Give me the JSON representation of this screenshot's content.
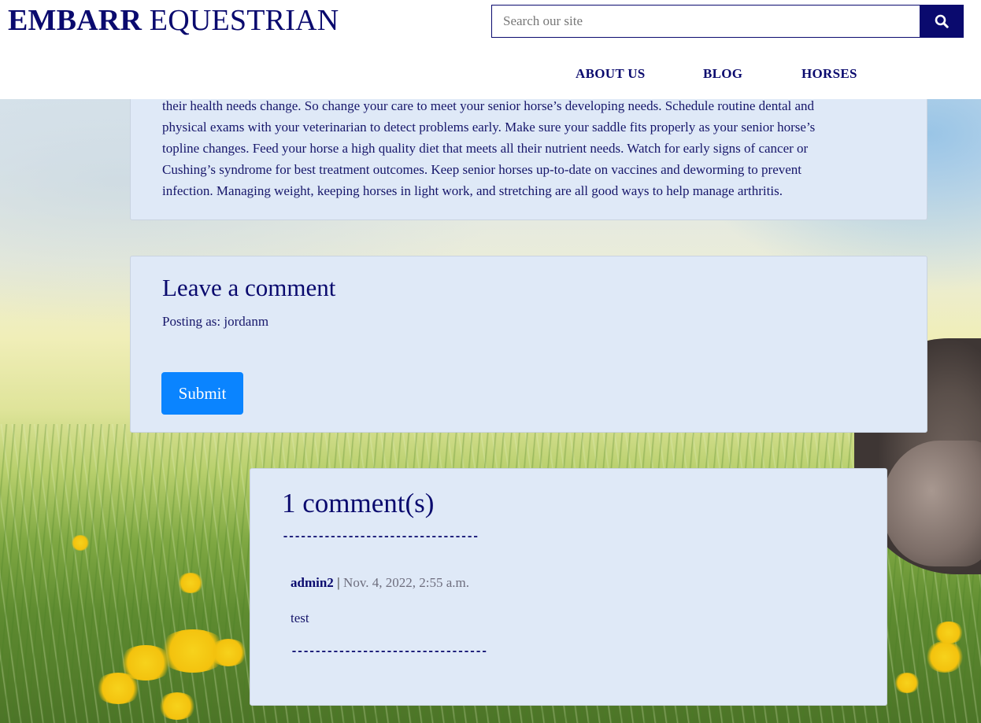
{
  "brand": {
    "bold": "EMBARR",
    "rest": "EQUESTRIAN"
  },
  "search": {
    "placeholder": "Search our site",
    "icon": "search-icon"
  },
  "nav": {
    "items": [
      {
        "label": "ABOUT US"
      },
      {
        "label": "BLOG"
      },
      {
        "label": "HORSES"
      }
    ]
  },
  "article": {
    "lines": [
      "their health needs change. So change your care to meet your senior horse’s developing needs. Schedule routine dental and",
      "physical exams with your veterinarian to detect problems early. Make sure your saddle fits properly as your senior horse’s",
      "topline changes. Feed your horse a high quality diet that meets all their nutrient needs. Watch for early signs of cancer or",
      "Cushing’s syndrome for best treatment outcomes. Keep senior horses up-to-date on vaccines and deworming to prevent",
      "infection. Managing weight, keeping horses in light work, and stretching are all good ways to help manage arthritis."
    ]
  },
  "comment_form": {
    "title": "Leave a comment",
    "posting_as": "Posting as: jordanm",
    "submit_label": "Submit"
  },
  "comments": {
    "title": "1 comment(s)",
    "divider": "---------------------------------",
    "items": [
      {
        "author": "admin2",
        "separator": "|",
        "date": "Nov. 4, 2022, 2:55 a.m.",
        "body": "test"
      }
    ]
  },
  "colors": {
    "brand_navy": "#0a0a6e",
    "card_background": "#dfe9f7",
    "submit_blue": "#0a84ff"
  }
}
